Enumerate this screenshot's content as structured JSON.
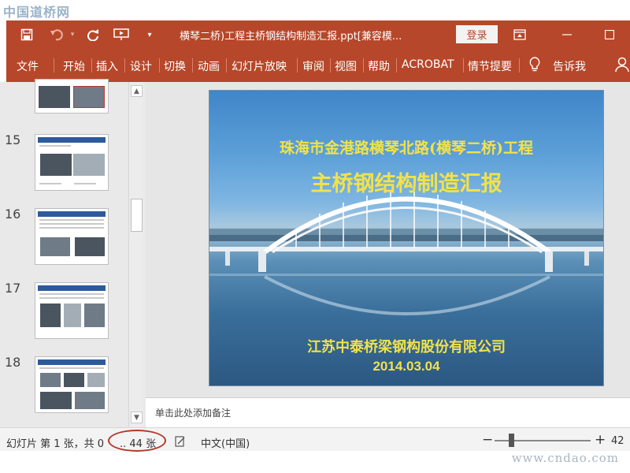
{
  "watermark": {
    "top_text": "中国道桥网",
    "bottom_text": "www.cndao.com"
  },
  "titlebar": {
    "save_icon": "save-icon",
    "undo_icon": "undo-icon",
    "redo_icon": "redo-icon",
    "present_icon": "present-from-start-icon",
    "customize_icon": "customize-toolbar-icon",
    "document_title": "横琴二桥)工程主桥钢结构制造汇报.ppt[兼容模...",
    "login_label": "登录",
    "accent_color": "#b7472a"
  },
  "ribbon": {
    "tabs": [
      "文件",
      "开始",
      "插入",
      "设计",
      "切换",
      "动画",
      "幻灯片放映",
      "审阅",
      "视图",
      "帮助",
      "ACROBAT",
      "情节提要"
    ],
    "tell_me_label": "告诉我",
    "tell_me_icon": "lightbulb-icon",
    "account_icon": "person-icon"
  },
  "thumbnails": {
    "numbers": [
      "15",
      "16",
      "17",
      "18"
    ]
  },
  "slide": {
    "title_line1": "珠海市金港路横琴北路(横琴二桥)工程",
    "title_line2": "主桥钢结构制造汇报",
    "company": "江苏中泰桥梁钢构股份有限公司",
    "date": "2014.03.04",
    "text_color": "#f2e24a"
  },
  "notes": {
    "placeholder": "单击此处添加备注"
  },
  "statusbar": {
    "slide_label": "幻灯片 第 1 张，共 0",
    "slide_total": ".. 44 张",
    "language": "中文(中国)",
    "zoom_minus": "−",
    "zoom_plus": "+",
    "zoom_percent": "42"
  }
}
